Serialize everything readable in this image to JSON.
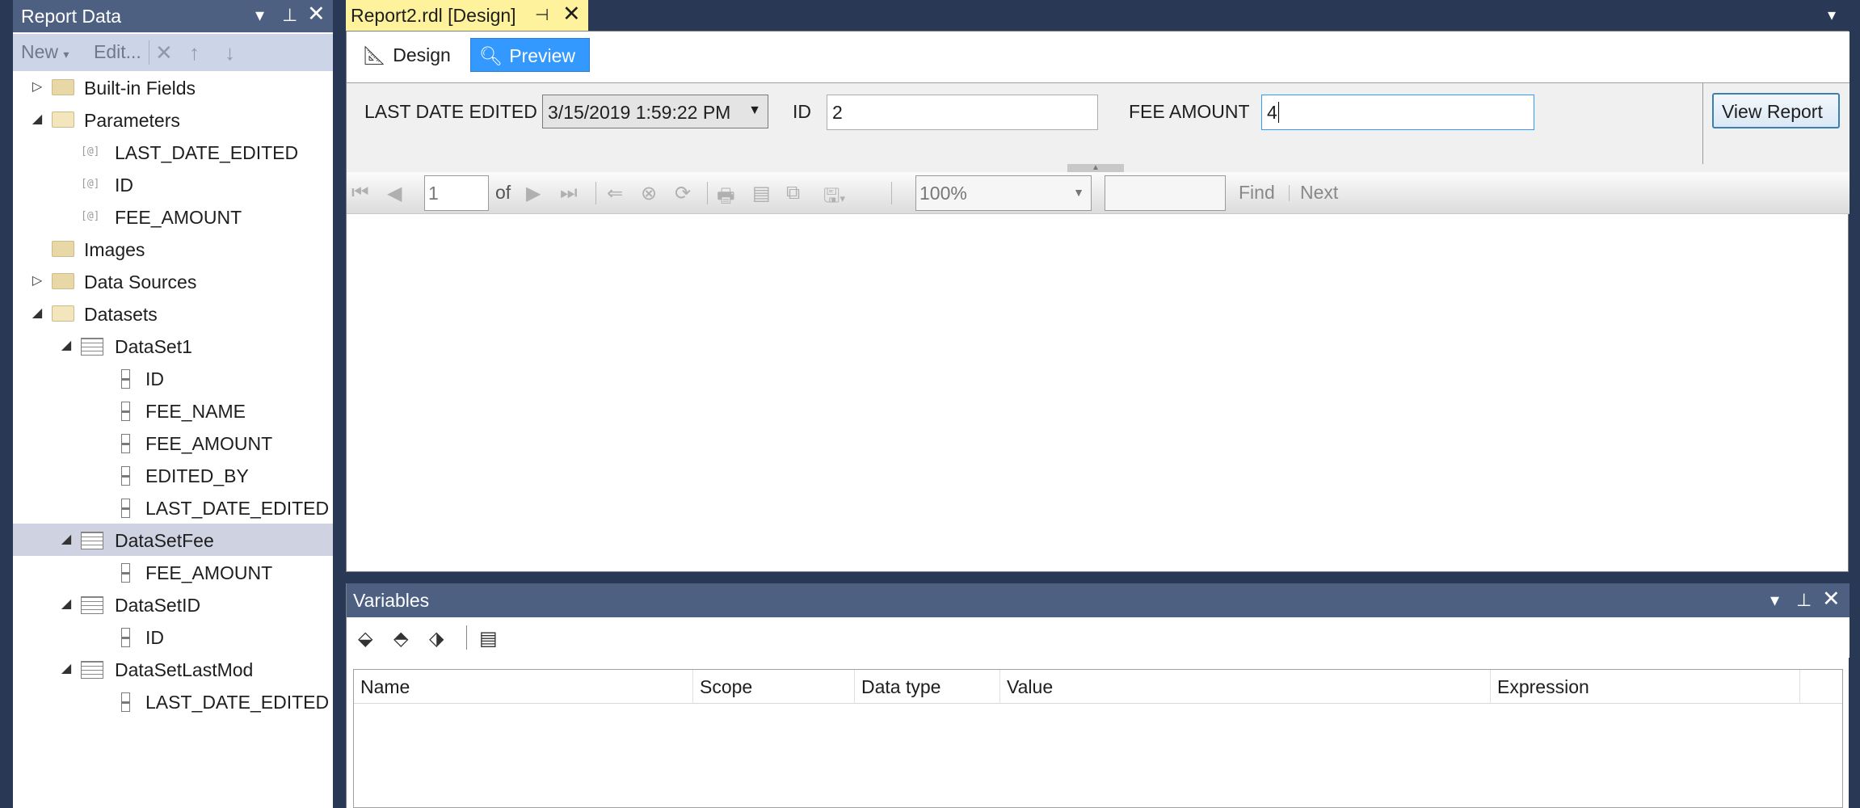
{
  "report_data_panel": {
    "title": "Report Data",
    "toolbar": {
      "new_label": "New",
      "edit_label": "Edit..."
    },
    "tree": {
      "builtin_fields": "Built-in Fields",
      "parameters": "Parameters",
      "param_items": [
        "LAST_DATE_EDITED",
        "ID",
        "FEE_AMOUNT"
      ],
      "images": "Images",
      "data_sources": "Data Sources",
      "datasets": "Datasets",
      "dataset1": "DataSet1",
      "dataset1_fields": [
        "ID",
        "FEE_NAME",
        "FEE_AMOUNT",
        "EDITED_BY",
        "LAST_DATE_EDITED"
      ],
      "datasetfee": "DataSetFee",
      "datasetfee_fields": [
        "FEE_AMOUNT"
      ],
      "datasetid": "DataSetID",
      "datasetid_fields": [
        "ID"
      ],
      "datasetlastmod": "DataSetLastMod",
      "datasetlastmod_fields": [
        "LAST_DATE_EDITED"
      ]
    }
  },
  "document_tab": {
    "title": "Report2.rdl [Design]"
  },
  "view_tabs": {
    "design": "Design",
    "preview": "Preview",
    "active": "Preview"
  },
  "parameters": {
    "last_date_label": "LAST DATE EDITED",
    "last_date_value": "3/15/2019 1:59:22 PM",
    "id_label": "ID",
    "id_value": "2",
    "fee_label": "FEE AMOUNT",
    "fee_value": "4",
    "view_report": "View Report"
  },
  "report_toolbar": {
    "page": "1",
    "of": "of",
    "zoom": "100%",
    "find": "Find",
    "next": "Next"
  },
  "variables_panel": {
    "title": "Variables",
    "columns": [
      "Name",
      "Scope",
      "Data type",
      "Value",
      "Expression"
    ]
  },
  "colors": {
    "ide_background": "#293955",
    "panel_title": "#4d6082",
    "active_tab": "#fff29d",
    "preview_tab": "#3399ff",
    "selected_row": "#cfd3e1"
  }
}
